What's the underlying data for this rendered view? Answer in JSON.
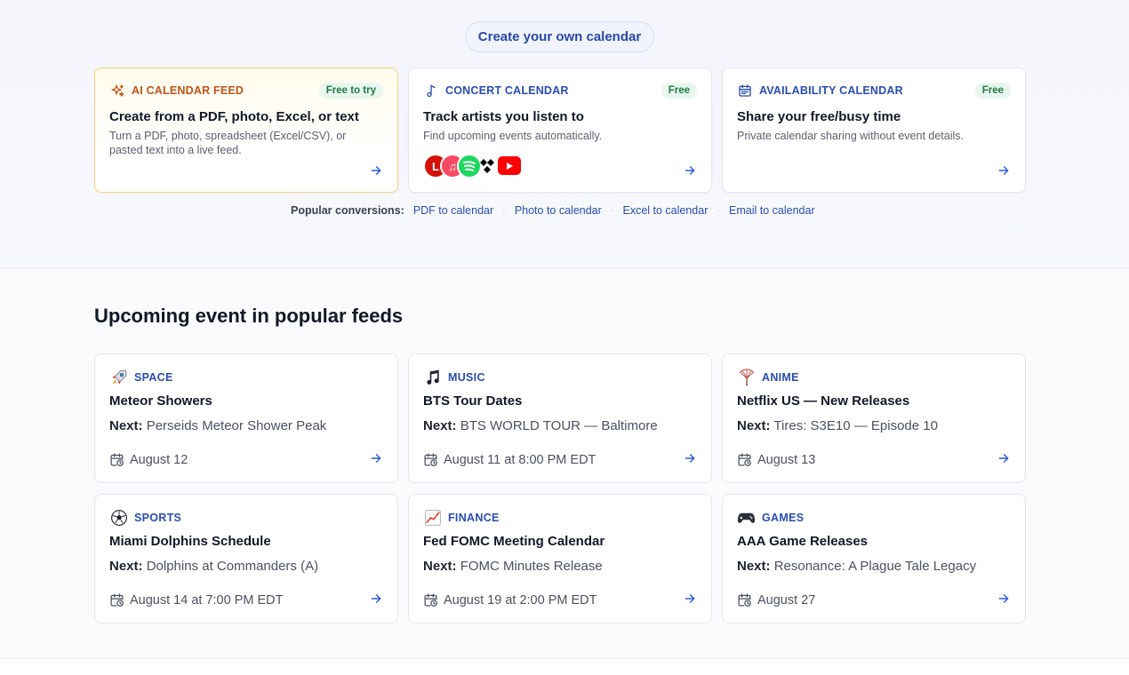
{
  "header": {
    "cta_label": "Create your own calendar"
  },
  "tools": [
    {
      "kicker": "AI CALENDAR FEED",
      "badge": "Free to try",
      "title": "Create from a PDF, photo, Excel, or text",
      "description": "Turn a PDF, photo, spreadsheet (Excel/CSV), or pasted text into a live feed.",
      "icon": "sparkles-icon"
    },
    {
      "kicker": "CONCERT CALENDAR",
      "badge": "Free",
      "title": "Track artists you listen to",
      "description": "Find upcoming events automatically.",
      "icon": "music-note-icon",
      "platform_icons": [
        "lastfm-icon",
        "apple-music-icon",
        "spotify-icon",
        "deezer-icon",
        "youtube-icon"
      ]
    },
    {
      "kicker": "AVAILABILITY CALENDAR",
      "badge": "Free",
      "title": "Share your free/busy time",
      "description": "Private calendar sharing without event details.",
      "icon": "calendar-icon"
    }
  ],
  "conversions": {
    "label": "Popular conversions:",
    "links": [
      "PDF to calendar",
      "Photo to calendar",
      "Excel to calendar",
      "Email to calendar"
    ],
    "separator": "·"
  },
  "feeds": {
    "heading": "Upcoming event in popular feeds",
    "next_label": "Next:",
    "items": [
      {
        "icon": "rocket-icon",
        "kicker": "SPACE",
        "title": "Meteor Showers",
        "next": "Perseids Meteor Shower Peak",
        "date": "August 12"
      },
      {
        "icon": "music-notes-icon",
        "kicker": "MUSIC",
        "title": "BTS Tour Dates",
        "next": "BTS WORLD TOUR — Baltimore",
        "date": "August 11 at 8:00 PM EDT"
      },
      {
        "icon": "paper-fan-icon",
        "kicker": "ANIME",
        "title": "Netflix US — New Releases",
        "next": "Tires: S3E10 — Episode 10",
        "date": "August 13"
      },
      {
        "icon": "soccer-ball-icon",
        "kicker": "SPORTS",
        "title": "Miami Dolphins Schedule",
        "next": "Dolphins at Commanders (A)",
        "date": "August 14 at 7:00 PM EDT"
      },
      {
        "icon": "chart-up-icon",
        "kicker": "FINANCE",
        "title": "Fed FOMC Meeting Calendar",
        "next": "FOMC Minutes Release",
        "date": "August 19 at 2:00 PM EDT"
      },
      {
        "icon": "game-controller-icon",
        "kicker": "GAMES",
        "title": "AAA Game Releases",
        "next": "Resonance: A Plague Tale Legacy",
        "date": "August 27"
      }
    ]
  },
  "colors": {
    "accent_blue": "#2a4db1",
    "ai_orange": "#c0541a",
    "badge_green": "#1f7a45",
    "highlight_border": "#f3d27a"
  }
}
